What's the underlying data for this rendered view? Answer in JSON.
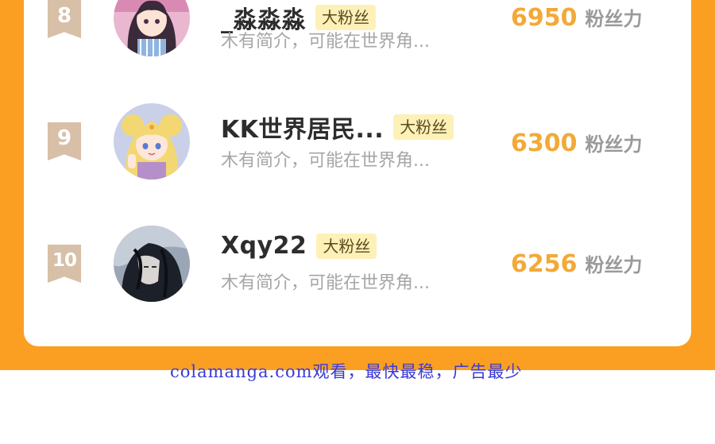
{
  "ranking": {
    "entries": [
      {
        "rank": "8",
        "name": "_淼淼淼",
        "badge": "大粉丝",
        "intro": "木有简介，可能在世界角...",
        "score": "6950",
        "score_unit": "粉丝力",
        "avatar_icon": "anime-girl-dark-hair-avatar"
      },
      {
        "rank": "9",
        "name": "KK世界居民...",
        "badge": "大粉丝",
        "intro": "木有简介，可能在世界角...",
        "score": "6300",
        "score_unit": "粉丝力",
        "avatar_icon": "anime-girl-blonde-avatar"
      },
      {
        "rank": "10",
        "name": "Xqy22",
        "badge": "大粉丝",
        "intro": "木有简介，可能在世界角...",
        "score": "6256",
        "score_unit": "粉丝力",
        "avatar_icon": "dark-haired-figure-avatar"
      }
    ]
  },
  "watermark": "colamanga.com观看，最快最稳，广告最少",
  "colors": {
    "frame": "#fb9f22",
    "rank_ribbon": "#d7c0a7",
    "score": "#f3a938",
    "badge_bg": "#fdf1b8",
    "watermark": "#3a3ad6"
  }
}
